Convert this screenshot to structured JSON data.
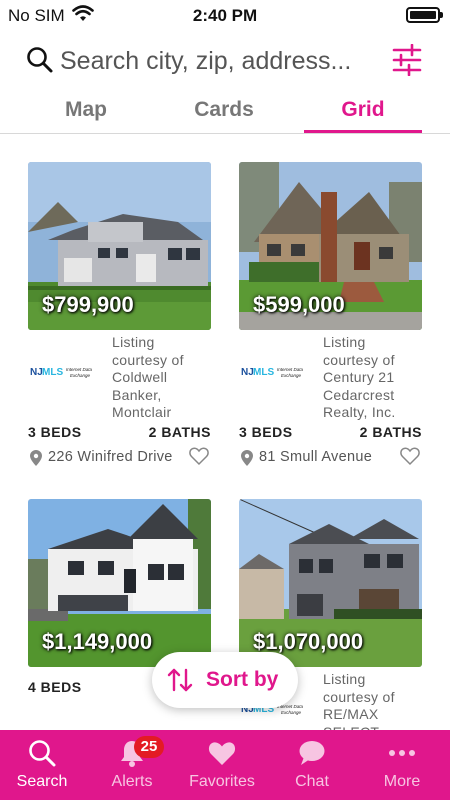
{
  "status_bar": {
    "carrier": "No SIM",
    "time": "2:40 PM"
  },
  "search": {
    "placeholder": "Search city, zip, address..."
  },
  "tabs": [
    {
      "label": "Map"
    },
    {
      "label": "Cards"
    },
    {
      "label": "Grid",
      "active": true
    }
  ],
  "listings": [
    {
      "price": "$799,900",
      "courtesy": "Listing courtesy of Coldwell Banker, Montclair",
      "beds": "3 BEDS",
      "baths": "2 BATHS",
      "address": "226 Winifred Drive"
    },
    {
      "price": "$599,000",
      "courtesy": "Listing courtesy of Century 21 Cedarcrest Realty, Inc.",
      "beds": "3 BEDS",
      "baths": "2 BATHS",
      "address": "81 Smull Avenue"
    },
    {
      "price": "$1,149,000",
      "beds": "4 BEDS"
    },
    {
      "price": "$1,070,000",
      "courtesy": "Listing courtesy of RE/MAX SELECT"
    }
  ],
  "sort_button": {
    "label": "Sort by"
  },
  "nav": {
    "items": [
      {
        "label": "Search",
        "icon": "search-icon",
        "active": true
      },
      {
        "label": "Alerts",
        "icon": "bell-icon",
        "badge": "25"
      },
      {
        "label": "Favorites",
        "icon": "heart-icon"
      },
      {
        "label": "Chat",
        "icon": "chat-icon"
      },
      {
        "label": "More",
        "icon": "more-icon"
      }
    ]
  },
  "colors": {
    "accent": "#e0178c",
    "badge": "#e31b23",
    "nav_bg": "#e0178c"
  }
}
